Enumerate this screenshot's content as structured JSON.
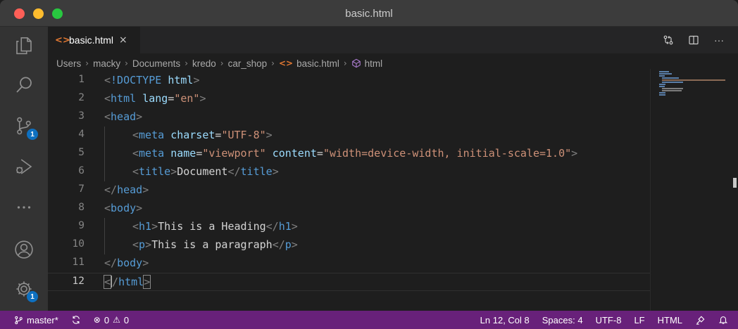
{
  "window": {
    "title": "basic.html"
  },
  "activity_bar": {
    "items": [
      {
        "name": "explorer",
        "icon": "files-icon"
      },
      {
        "name": "search",
        "icon": "search-icon"
      },
      {
        "name": "source-control",
        "icon": "source-control-icon",
        "badge": "1"
      },
      {
        "name": "run-debug",
        "icon": "run-debug-icon"
      },
      {
        "name": "more",
        "icon": "more-icon"
      }
    ],
    "bottom": [
      {
        "name": "accounts",
        "icon": "account-icon"
      },
      {
        "name": "manage",
        "icon": "gear-icon",
        "badge": "1"
      }
    ]
  },
  "tabs": [
    {
      "label": "basic.html",
      "icon": "html-file-icon",
      "icon_glyph": "<>",
      "close": "×",
      "active": true
    }
  ],
  "tab_actions": [
    {
      "name": "open-changes",
      "icon": "git-compare-icon"
    },
    {
      "name": "split-editor",
      "icon": "split-editor-icon"
    },
    {
      "name": "more-actions",
      "icon": "ellipsis-icon",
      "glyph": "···"
    }
  ],
  "breadcrumb": {
    "segments": [
      "Users",
      "macky",
      "Documents",
      "kredo",
      "car_shop"
    ],
    "file": "basic.html",
    "symbol": "html",
    "separator": "›"
  },
  "editor": {
    "lines": [
      {
        "n": "1",
        "tokens": [
          [
            "tok-punc",
            "<"
          ],
          [
            "tok-doc",
            "!DOCTYPE "
          ],
          [
            "tok-attr",
            "html"
          ],
          [
            "tok-punc",
            ">"
          ]
        ]
      },
      {
        "n": "2",
        "tokens": [
          [
            "tok-punc",
            "<"
          ],
          [
            "tok-tag",
            "html "
          ],
          [
            "tok-attr",
            "lang"
          ],
          [
            "tok-txt",
            "="
          ],
          [
            "tok-str",
            "\"en\""
          ],
          [
            "tok-punc",
            ">"
          ]
        ]
      },
      {
        "n": "3",
        "tokens": [
          [
            "tok-punc",
            "<"
          ],
          [
            "tok-tag",
            "head"
          ],
          [
            "tok-punc",
            ">"
          ]
        ]
      },
      {
        "n": "4",
        "indent": 1,
        "tokens": [
          [
            "tok-punc",
            "<"
          ],
          [
            "tok-tag",
            "meta "
          ],
          [
            "tok-attr",
            "charset"
          ],
          [
            "tok-txt",
            "="
          ],
          [
            "tok-str",
            "\"UTF-8\""
          ],
          [
            "tok-punc",
            ">"
          ]
        ]
      },
      {
        "n": "5",
        "indent": 1,
        "tokens": [
          [
            "tok-punc",
            "<"
          ],
          [
            "tok-tag",
            "meta "
          ],
          [
            "tok-attr",
            "name"
          ],
          [
            "tok-txt",
            "="
          ],
          [
            "tok-str",
            "\"viewport\" "
          ],
          [
            "tok-attr",
            "content"
          ],
          [
            "tok-txt",
            "="
          ],
          [
            "tok-str",
            "\"width=device-width, initial-scale=1.0\""
          ],
          [
            "tok-punc",
            ">"
          ]
        ]
      },
      {
        "n": "6",
        "indent": 1,
        "tokens": [
          [
            "tok-punc",
            "<"
          ],
          [
            "tok-tag",
            "title"
          ],
          [
            "tok-punc",
            ">"
          ],
          [
            "tok-txt",
            "Document"
          ],
          [
            "tok-punc",
            "</"
          ],
          [
            "tok-tag",
            "title"
          ],
          [
            "tok-punc",
            ">"
          ]
        ]
      },
      {
        "n": "7",
        "tokens": [
          [
            "tok-punc",
            "</"
          ],
          [
            "tok-tag",
            "head"
          ],
          [
            "tok-punc",
            ">"
          ]
        ]
      },
      {
        "n": "8",
        "tokens": [
          [
            "tok-punc",
            "<"
          ],
          [
            "tok-tag",
            "body"
          ],
          [
            "tok-punc",
            ">"
          ]
        ]
      },
      {
        "n": "9",
        "indent": 1,
        "tokens": [
          [
            "tok-punc",
            "<"
          ],
          [
            "tok-tag",
            "h1"
          ],
          [
            "tok-punc",
            ">"
          ],
          [
            "tok-txt",
            "This is a Heading"
          ],
          [
            "tok-punc",
            "</"
          ],
          [
            "tok-tag",
            "h1"
          ],
          [
            "tok-punc",
            ">"
          ]
        ]
      },
      {
        "n": "10",
        "indent": 1,
        "tokens": [
          [
            "tok-punc",
            "<"
          ],
          [
            "tok-tag",
            "p"
          ],
          [
            "tok-punc",
            ">"
          ],
          [
            "tok-txt",
            "This is a paragraph"
          ],
          [
            "tok-punc",
            "</"
          ],
          [
            "tok-tag",
            "p"
          ],
          [
            "tok-punc",
            ">"
          ]
        ]
      },
      {
        "n": "11",
        "tokens": [
          [
            "tok-punc",
            "</"
          ],
          [
            "tok-tag",
            "body"
          ],
          [
            "tok-punc",
            ">"
          ]
        ]
      },
      {
        "n": "12",
        "current": true,
        "tokens": [
          [
            "tok-punc bracket-box",
            "<"
          ],
          [
            "cursor",
            ""
          ],
          [
            "tok-punc",
            "/"
          ],
          [
            "tok-tag",
            "html"
          ],
          [
            "tok-punc bracket-box",
            ">"
          ]
        ]
      }
    ]
  },
  "status_bar": {
    "branch": "master*",
    "branch_icon": "git-branch-icon",
    "sync_icon": "sync-icon",
    "errors": "0",
    "warnings": "0",
    "cursor_position": "Ln 12, Col 8",
    "indentation": "Spaces: 4",
    "encoding": "UTF-8",
    "eol": "LF",
    "language": "HTML",
    "feedback_icon": "feedback-icon",
    "notifications_icon": "bell-icon"
  },
  "colors": {
    "status_bar": "#68217a",
    "activity_bar": "#333333",
    "editor_bg": "#1e1e1e",
    "badge": "#0e70c0"
  }
}
